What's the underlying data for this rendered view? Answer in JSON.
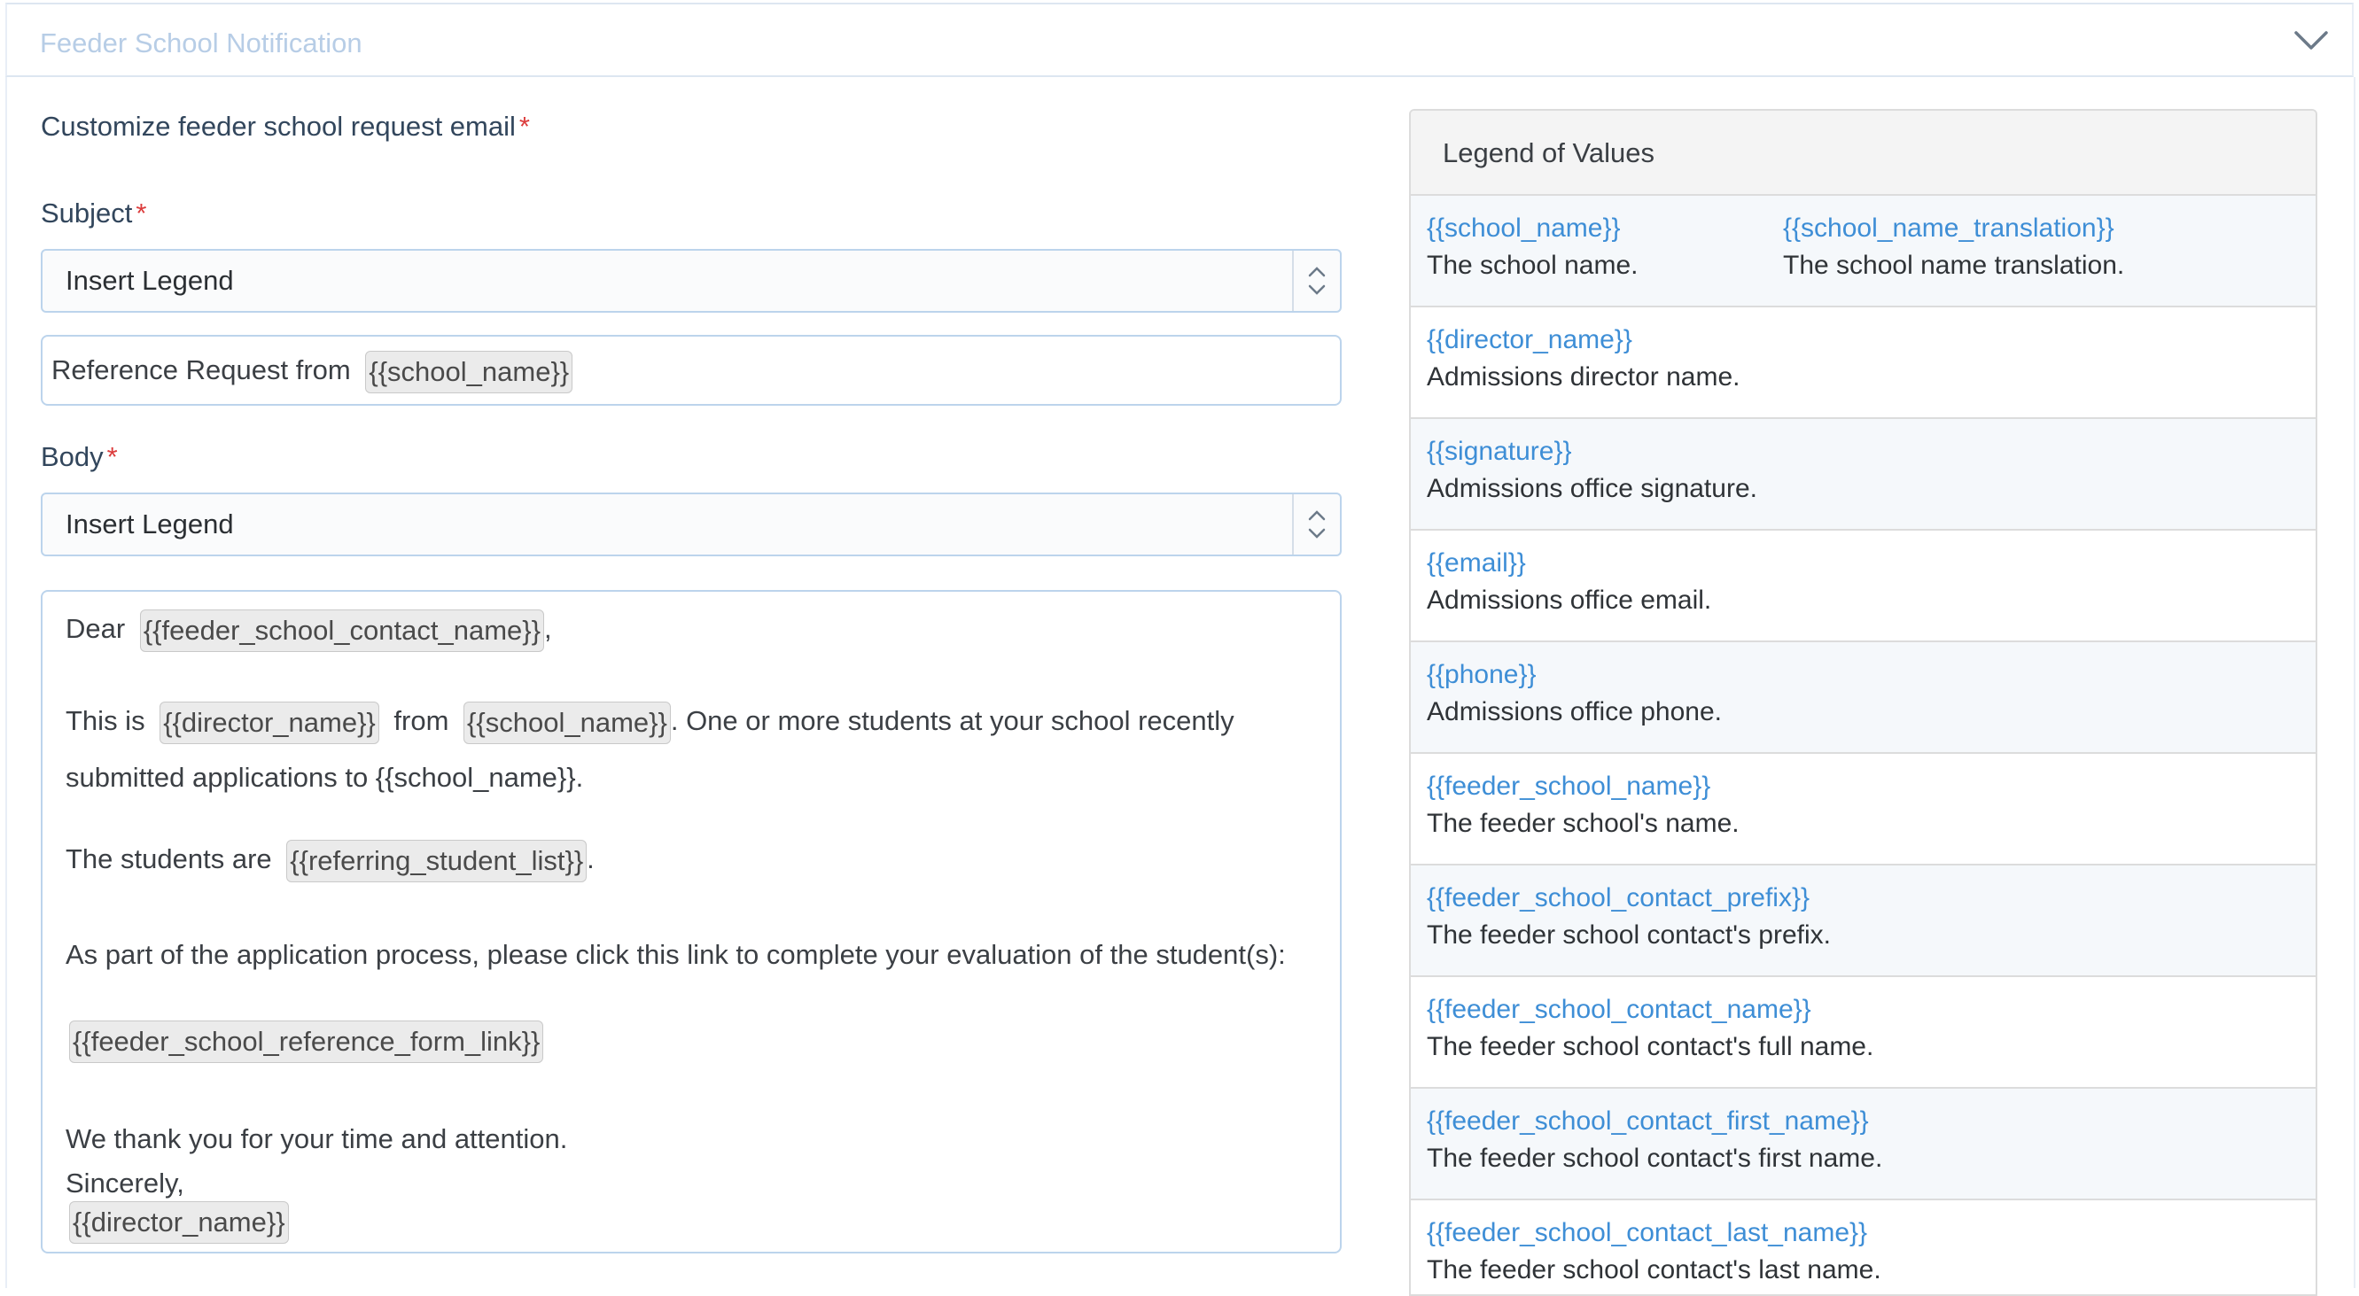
{
  "section": {
    "title": "Feeder School Notification"
  },
  "form": {
    "customize_label": "Customize feeder school request email",
    "required_mark": "*",
    "subject": {
      "label": "Subject",
      "select_value": "Insert Legend",
      "text_prefix": "Reference Request from",
      "text_chip": "{{school_name}}"
    },
    "body": {
      "label": "Body",
      "select_value": "Insert Legend",
      "line1_prefix": "Dear",
      "line1_chip": "{{feeder_school_contact_name}}",
      "line1_suffix": ",",
      "line2_prefix": "This is",
      "line2_chip1": "{{director_name}}",
      "line2_mid": "from",
      "line2_chip2": "{{school_name}}",
      "line2_suffix": ". One or more students at your school recently",
      "line3": "submitted applications to {{school_name}}.",
      "line4_prefix": "The students are",
      "line4_chip": "{{referring_student_list}}",
      "line4_suffix": ".",
      "line5": "As part of the application process, please click this link to complete your evaluation of the student(s):",
      "line6_chip": "{{feeder_school_reference_form_link}}",
      "line7": "We thank you for your time and attention.",
      "line8": "Sincerely,",
      "line9_chip": "{{director_name}}"
    }
  },
  "legend": {
    "title": "Legend of Values",
    "items": [
      {
        "key": "{{school_name}}",
        "desc": "The school name.",
        "key2": "{{school_name_translation}}",
        "desc2": "The school name translation."
      },
      {
        "key": "{{director_name}}",
        "desc": "Admissions director name."
      },
      {
        "key": "{{signature}}",
        "desc": "Admissions office signature."
      },
      {
        "key": "{{email}}",
        "desc": "Admissions office email."
      },
      {
        "key": "{{phone}}",
        "desc": "Admissions office phone."
      },
      {
        "key": "{{feeder_school_name}}",
        "desc": "The feeder school's name."
      },
      {
        "key": "{{feeder_school_contact_prefix}}",
        "desc": "The feeder school contact's prefix."
      },
      {
        "key": "{{feeder_school_contact_name}}",
        "desc": "The feeder school contact's full name."
      },
      {
        "key": "{{feeder_school_contact_first_name}}",
        "desc": "The feeder school contact's first name."
      },
      {
        "key": "{{feeder_school_contact_last_name}}",
        "desc": "The feeder school contact's last name."
      }
    ]
  },
  "colors": {
    "accent": "#3e8ed6",
    "required": "#dc3c3c",
    "border": "#bcd4ec"
  }
}
